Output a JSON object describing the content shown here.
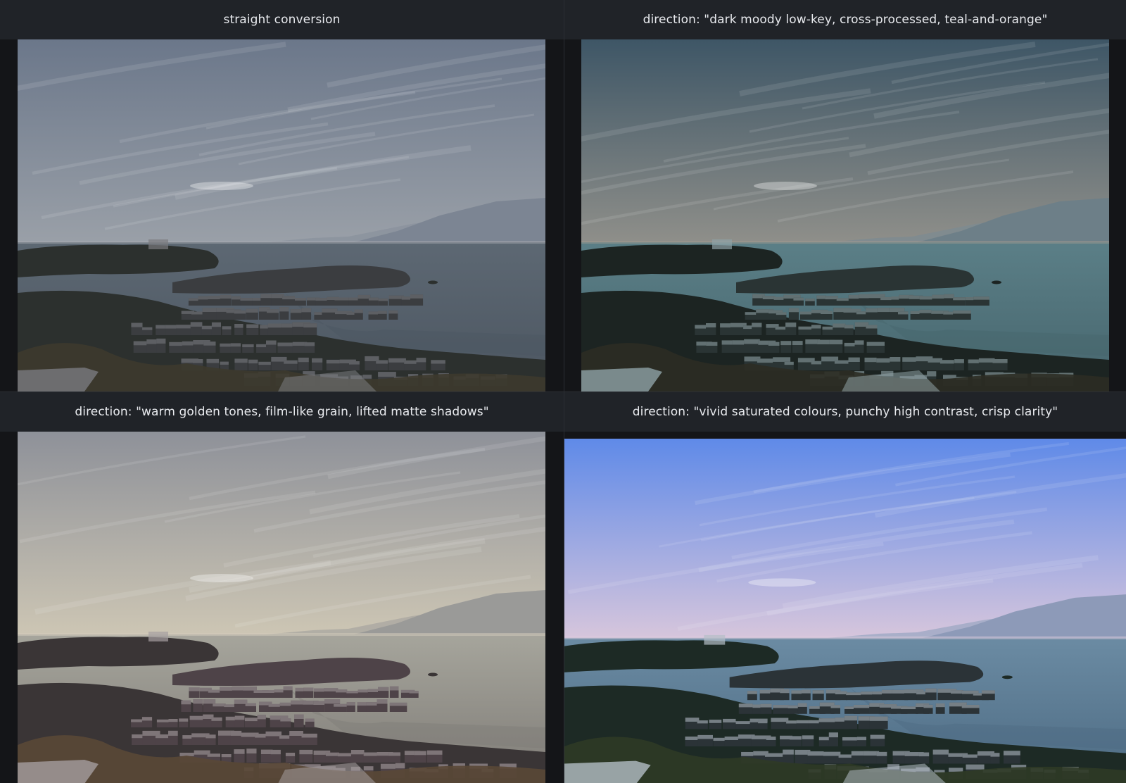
{
  "panels": [
    {
      "title": "straight conversion",
      "palette": {
        "skyTop": "#6b778a",
        "skyBottom": "#9aa0a8",
        "mtn": "#7c8593",
        "mtnFar": "#8c939e",
        "water": "#5d6873",
        "waterDark": "#4c5661",
        "land": "#2c302e",
        "town": "#3b3d40",
        "roof": "#7a7b7f",
        "fg": "#3d3a2e",
        "haze": "#a8aab0"
      }
    },
    {
      "title": "direction: \"dark moody low-key, cross-processed, teal-and-orange\"",
      "palette": {
        "skyTop": "#3e5666",
        "skyBottom": "#8f8f8a",
        "mtn": "#6d7f88",
        "mtnFar": "#7e8b90",
        "water": "#5b7f87",
        "waterDark": "#46656d",
        "land": "#1c2422",
        "town": "#2a3434",
        "roof": "#8fa2a6",
        "fg": "#2c2c24",
        "haze": "#a09a90"
      }
    },
    {
      "title": "direction: \"warm golden tones, film-like grain, lifted matte shadows\"",
      "palette": {
        "skyTop": "#8e9199",
        "skyBottom": "#cdc6b4",
        "mtn": "#9a9a98",
        "mtnFar": "#aeaba3",
        "water": "#a6a59c",
        "waterDark": "#7f7c77",
        "land": "#3a3536",
        "town": "#4e4348",
        "roof": "#a59ea0",
        "fg": "#5a4836",
        "haze": "#d3ccbb"
      }
    },
    {
      "title": "direction: \"vivid saturated colours, punchy high contrast, crisp clarity\"",
      "palette": {
        "skyTop": "#5f8ae8",
        "skyBottom": "#d7c6dc",
        "mtn": "#8d9ab8",
        "mtnFar": "#a4acc6",
        "water": "#6b8ba3",
        "waterDark": "#4d6b83",
        "land": "#1d2a25",
        "town": "#2b3337",
        "roof": "#b4bec6",
        "fg": "#2f3a26",
        "haze": "#e1cde0"
      }
    }
  ]
}
